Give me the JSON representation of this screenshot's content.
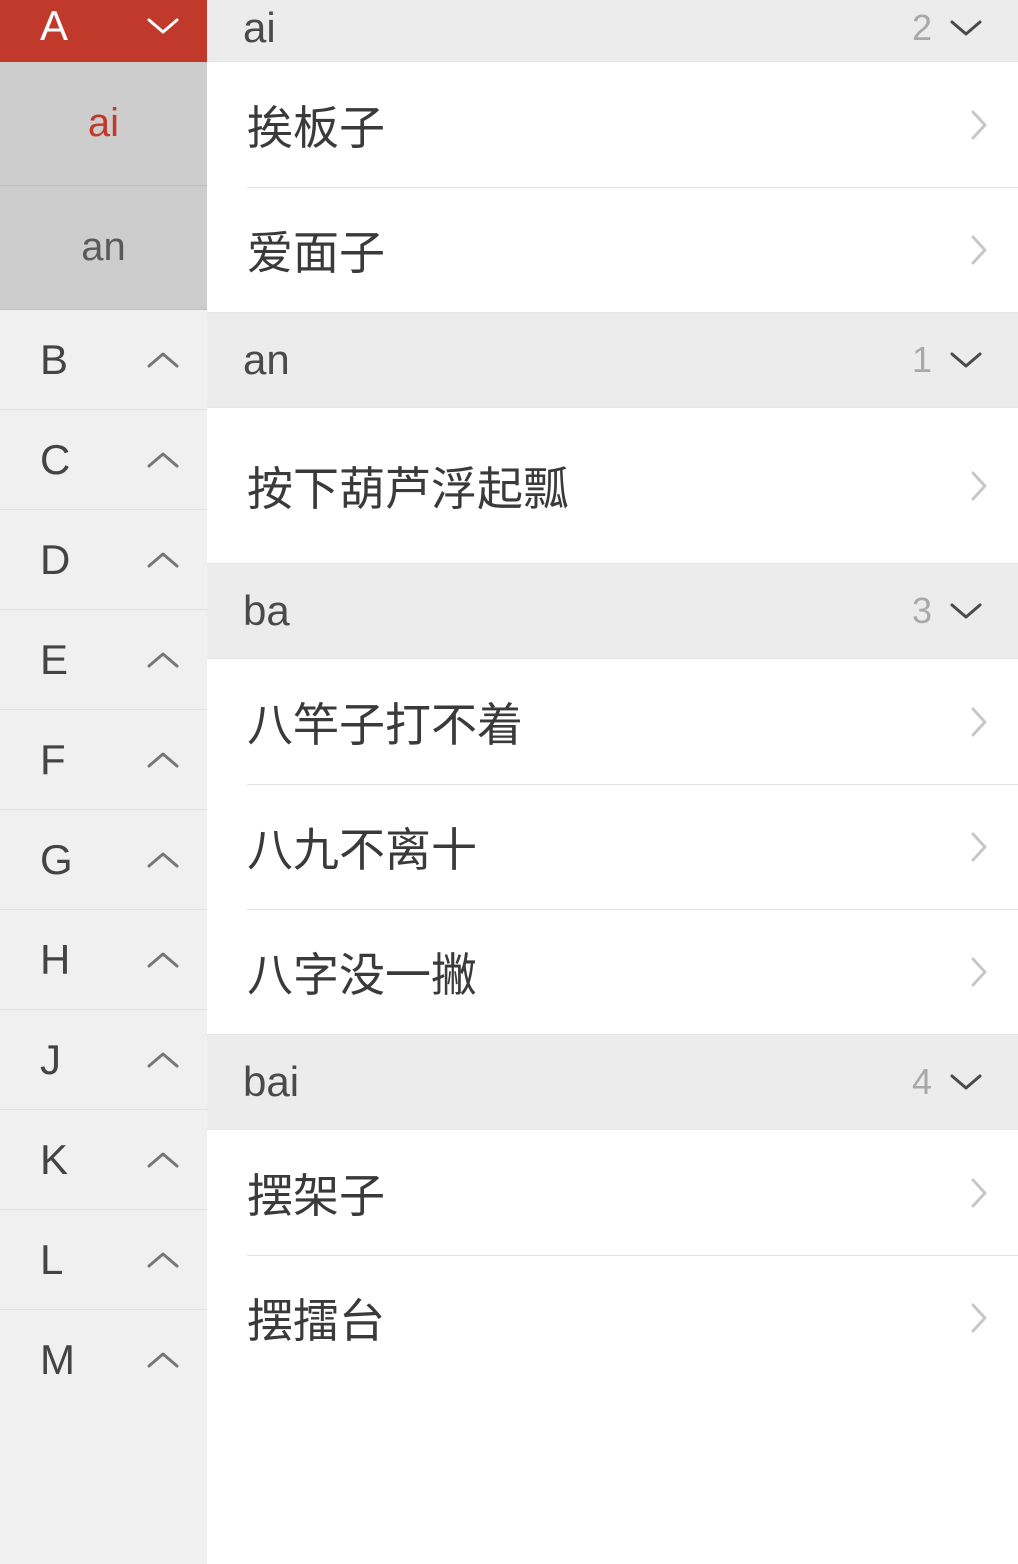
{
  "sidebar": {
    "current_letter": "A",
    "subs": [
      {
        "label": "ai",
        "active": true
      },
      {
        "label": "an",
        "active": false
      }
    ],
    "letters": [
      "B",
      "C",
      "D",
      "E",
      "F",
      "G",
      "H",
      "J",
      "K",
      "L",
      "M"
    ]
  },
  "groups": [
    {
      "pinyin": "ai",
      "count": "2",
      "entries": [
        "挨板子",
        "爱面子"
      ]
    },
    {
      "pinyin": "an",
      "count": "1",
      "entries": [
        "按下葫芦浮起瓢"
      ]
    },
    {
      "pinyin": "ba",
      "count": "3",
      "entries": [
        "八竿子打不着",
        "八九不离十",
        "八字没一撇"
      ]
    },
    {
      "pinyin": "bai",
      "count": "4",
      "entries": [
        "摆架子",
        "摆擂台"
      ]
    }
  ]
}
